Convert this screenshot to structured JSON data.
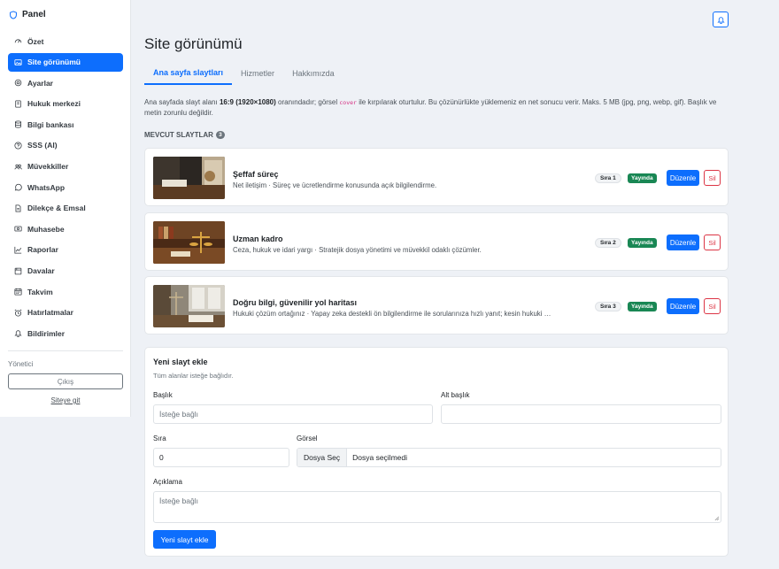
{
  "sidebar": {
    "brand": "Panel",
    "items": [
      {
        "label": "Özet",
        "icon": "gauge-icon"
      },
      {
        "label": "Site görünümü",
        "icon": "image-icon",
        "active": true
      },
      {
        "label": "Ayarlar",
        "icon": "gear-icon"
      },
      {
        "label": "Hukuk merkezi",
        "icon": "journal-icon"
      },
      {
        "label": "Bilgi bankası",
        "icon": "database-icon"
      },
      {
        "label": "SSS (AI)",
        "icon": "question-circle-icon"
      },
      {
        "label": "Müvekkiller",
        "icon": "people-icon"
      },
      {
        "label": "WhatsApp",
        "icon": "whatsapp-icon"
      },
      {
        "label": "Dilekçe & Emsal",
        "icon": "file-text-icon"
      },
      {
        "label": "Muhasebe",
        "icon": "cash-icon"
      },
      {
        "label": "Raporlar",
        "icon": "chart-line-icon"
      },
      {
        "label": "Davalar",
        "icon": "folder-icon"
      },
      {
        "label": "Takvim",
        "icon": "calendar-icon"
      },
      {
        "label": "Hatırlatmalar",
        "icon": "alarm-icon"
      },
      {
        "label": "Bildirimler",
        "icon": "bell-icon"
      }
    ],
    "role_label": "Yönetici",
    "logout_label": "Çıkış",
    "site_link": "Siteye git"
  },
  "header": {
    "title": "Site görünümü",
    "tabs": [
      {
        "label": "Ana sayfa slaytları",
        "active": true
      },
      {
        "label": "Hizmetler"
      },
      {
        "label": "Hakkımızda"
      }
    ]
  },
  "info": {
    "part1": "Ana sayfada slayt alanı ",
    "ratio": "16:9 (1920×1080)",
    "part2": " oranındadır; görsel ",
    "code": "cover",
    "part3": " ile kırpılarak oturtulur. Bu çözünürlükte yüklemeniz en net sonucu verir. Maks. 5 MB (jpg, png, webp, gif). Başlık ve metin zorunlu değildir."
  },
  "slides_section": {
    "label": "MEVCUT SLAYTLAR",
    "count": "3",
    "slides": [
      {
        "title": "Şeffaf süreç",
        "subtitle": "Net iletişim · Süreç ve ücretlendirme konusunda açık bilgilendirme.",
        "order": "Sıra 1",
        "status": "Yayında",
        "edit": "Düzenle",
        "delete": "Sil"
      },
      {
        "title": "Uzman kadro",
        "subtitle": "Ceza, hukuk ve idari yargı · Stratejik dosya yönetimi ve müvekkil odaklı çözümler.",
        "order": "Sıra 2",
        "status": "Yayında",
        "edit": "Düzenle",
        "delete": "Sil"
      },
      {
        "title": "Doğru bilgi, güvenilir yol haritası",
        "subtitle": "Hukuki çözüm ortağınız · Yapay zeka destekli ön bilgilendirme ile sorularınıza hızlı yanıt; kesin hukuki …",
        "order": "Sıra 3",
        "status": "Yayında",
        "edit": "Düzenle",
        "delete": "Sil"
      }
    ]
  },
  "form": {
    "title": "Yeni slayt ekle",
    "hint": "Tüm alanlar isteğe bağlıdır.",
    "title_label": "Başlık",
    "title_placeholder": "İsteğe bağlı",
    "subtitle_label": "Alt başlık",
    "subtitle_value": "",
    "order_label": "Sıra",
    "order_value": "0",
    "image_label": "Görsel",
    "file_button": "Dosya Seç",
    "file_status": "Dosya seçilmedi",
    "desc_label": "Açıklama",
    "desc_placeholder": "İsteğe bağlı",
    "submit": "Yeni slayt ekle"
  },
  "colors": {
    "primary": "#0d6efd",
    "success": "#198754",
    "danger": "#dc3545",
    "background": "#eef1f6"
  }
}
